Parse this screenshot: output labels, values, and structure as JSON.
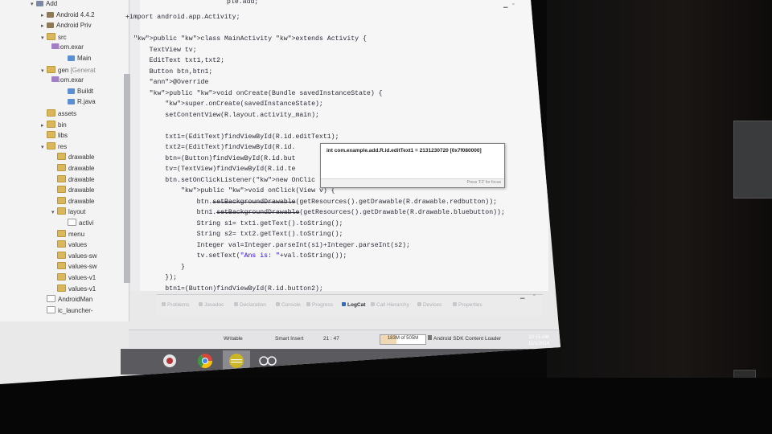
{
  "explorer": {
    "items": [
      {
        "label": "Add",
        "indent": 0,
        "twisty": "▾",
        "icon": "proj"
      },
      {
        "label": "Android 4.4.2",
        "indent": 1,
        "twisty": "▸",
        "icon": "lib"
      },
      {
        "label": "Android Priv",
        "indent": 1,
        "twisty": "▸",
        "icon": "lib"
      },
      {
        "label": "src",
        "indent": 1,
        "twisty": "▾",
        "icon": "folder"
      },
      {
        "label": "com.exar",
        "indent": 2,
        "twisty": "▾",
        "icon": "pkg"
      },
      {
        "label": "Main",
        "indent": 3,
        "twisty": "",
        "icon": "java"
      },
      {
        "label": "gen",
        "decoration": "[Generat",
        "indent": 1,
        "twisty": "▾",
        "icon": "folder"
      },
      {
        "label": "com.exar",
        "indent": 2,
        "twisty": "▾",
        "icon": "pkg"
      },
      {
        "label": "Buildt",
        "indent": 3,
        "twisty": "",
        "icon": "java"
      },
      {
        "label": "R.java",
        "indent": 3,
        "twisty": "",
        "icon": "java"
      },
      {
        "label": "assets",
        "indent": 1,
        "twisty": "",
        "icon": "folder"
      },
      {
        "label": "bin",
        "indent": 1,
        "twisty": "▸",
        "icon": "folder"
      },
      {
        "label": "libs",
        "indent": 1,
        "twisty": "",
        "icon": "folder"
      },
      {
        "label": "res",
        "indent": 1,
        "twisty": "▾",
        "icon": "folder"
      },
      {
        "label": "drawable",
        "indent": 2,
        "twisty": "",
        "icon": "folder"
      },
      {
        "label": "drawable",
        "indent": 2,
        "twisty": "",
        "icon": "folder"
      },
      {
        "label": "drawable",
        "indent": 2,
        "twisty": "",
        "icon": "folder"
      },
      {
        "label": "drawable",
        "indent": 2,
        "twisty": "",
        "icon": "folder"
      },
      {
        "label": "drawable",
        "indent": 2,
        "twisty": "",
        "icon": "folder"
      },
      {
        "label": "layout",
        "indent": 2,
        "twisty": "▾",
        "icon": "folder"
      },
      {
        "label": "activi",
        "indent": 3,
        "twisty": "",
        "icon": "file"
      },
      {
        "label": "menu",
        "indent": 2,
        "twisty": "",
        "icon": "folder"
      },
      {
        "label": "values",
        "indent": 2,
        "twisty": "",
        "icon": "folder"
      },
      {
        "label": "values-sw",
        "indent": 2,
        "twisty": "",
        "icon": "folder"
      },
      {
        "label": "values-sw",
        "indent": 2,
        "twisty": "",
        "icon": "folder"
      },
      {
        "label": "values-v1",
        "indent": 2,
        "twisty": "",
        "icon": "folder"
      },
      {
        "label": "values-v1",
        "indent": 2,
        "twisty": "",
        "icon": "folder"
      },
      {
        "label": "AndroidMan",
        "indent": 1,
        "twisty": "",
        "icon": "file"
      },
      {
        "label": "ic_launcher-",
        "indent": 1,
        "twisty": "",
        "icon": "file"
      }
    ]
  },
  "editor": {
    "top_fragment": "ple.add;",
    "lines": [
      "+import android.app.Activity;",
      "",
      "public class MainActivity extends Activity {",
      "    TextView tv;",
      "    EditText txt1,txt2;",
      "    Button btn,btn1;",
      "    @Override",
      "    public void onCreate(Bundle savedInstanceState) {",
      "        super.onCreate(savedInstanceState);",
      "        setContentView(R.layout.activity_main);",
      "",
      "        txt1=(EditText)findViewById(R.id.editText1);",
      "        txt2=(EditText)findViewById(R.id.",
      "        btn=(Button)findViewById(R.id.but",
      "        tv=(TextView)findViewById(R.id.te",
      "        btn.setOnClickListener(new OnClic",
      "            public void onClick(View v) {",
      "                btn.setBackgroundDrawable(getResources().getDrawable(R.drawable.redbutton));",
      "                btn1.setBackgroundDrawable(getResources().getDrawable(R.drawable.bluebutton));",
      "                String s1= txt1.getText().toString();",
      "                String s2= txt2.getText().toString();",
      "                Integer val=Integer.parseInt(s1)+Integer.parseInt(s2);",
      "                tv.setText(\"Ans is: \"+val.toString());",
      "            }",
      "        });",
      "        btn1=(Button)findViewById(R.id.button2);"
    ],
    "hover": {
      "text": "int com.example.add.R.id.editText1 = 2131230720 [0x7f080000]",
      "hint": "Press 'F2' for focus"
    }
  },
  "views_tabs": [
    {
      "label": "Problems",
      "active": false
    },
    {
      "label": "Javadoc",
      "active": false
    },
    {
      "label": "Declaration",
      "active": false
    },
    {
      "label": "Console",
      "active": false
    },
    {
      "label": "Progress",
      "active": false
    },
    {
      "label": "LogCat",
      "active": true
    },
    {
      "label": "Call Hierarchy",
      "active": false
    },
    {
      "label": "Devices",
      "active": false
    },
    {
      "label": "Properties",
      "active": false
    }
  ],
  "status_bar": {
    "writable": "Writable",
    "insert_mode": "Smart Insert",
    "position": "21 : 47",
    "heap": "183M of 505M",
    "heap_fraction": 0.36,
    "task": "Android SDK Content Loader"
  },
  "taskbar": {
    "time": "10:15 AM",
    "date": "11/1/2014"
  }
}
